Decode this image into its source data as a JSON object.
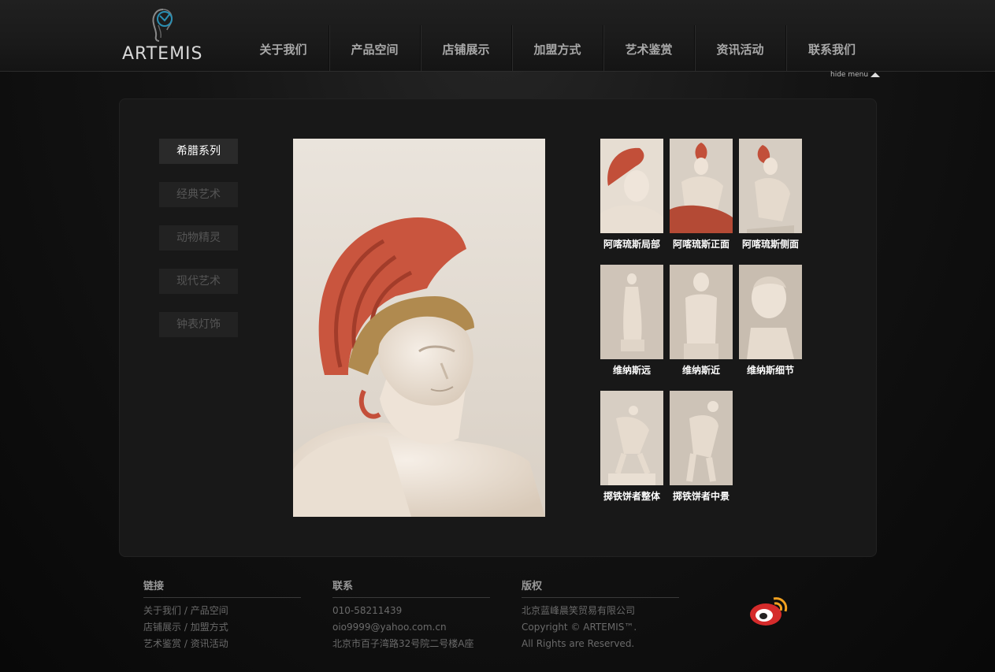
{
  "brand": {
    "name": "ARTEMIS"
  },
  "nav": {
    "items": [
      "关于我们",
      "产品空间",
      "店铺展示",
      "加盟方式",
      "艺术鉴赏",
      "资讯活动",
      "联系我们"
    ],
    "hide_menu": "hide menu"
  },
  "categories": {
    "items": [
      "希腊系列",
      "经典艺术",
      "动物精灵",
      "现代艺术",
      "钟表灯饰"
    ],
    "active": "希腊系列"
  },
  "gallery": {
    "thumbs": [
      {
        "caption": "阿喀琉斯局部"
      },
      {
        "caption": "阿喀琉斯正面"
      },
      {
        "caption": "阿喀琉斯侧面"
      },
      {
        "caption": "维纳斯远"
      },
      {
        "caption": "维纳斯近"
      },
      {
        "caption": "维纳斯细节"
      },
      {
        "caption": "掷铁饼者整体"
      },
      {
        "caption": "掷铁饼者中景"
      }
    ]
  },
  "footer": {
    "links": {
      "title": "链接",
      "rows": [
        [
          "关于我们",
          "产品空间"
        ],
        [
          "店铺展示",
          "加盟方式"
        ],
        [
          "艺术鉴赏",
          "资讯活动"
        ]
      ],
      "separator": "/"
    },
    "contact": {
      "title": "联系",
      "phone": "010-58211439",
      "email": "oio9999@yahoo.com.cn",
      "address": "北京市百子湾路32号院二号楼A座"
    },
    "copyright": {
      "title": "版权",
      "company": "北京蓝峰晨笑贸易有限公司",
      "line1": "Copyright © ARTEMIS™.",
      "line2": "All Rights are Reserved."
    }
  },
  "colors": {
    "background": "#0c0c0c",
    "panel": "#181818",
    "crest": "#c8553f",
    "marble": "#efe6dc"
  },
  "icons": [
    "logo-head-icon",
    "hide-menu-arrow-icon",
    "weibo-icon"
  ]
}
